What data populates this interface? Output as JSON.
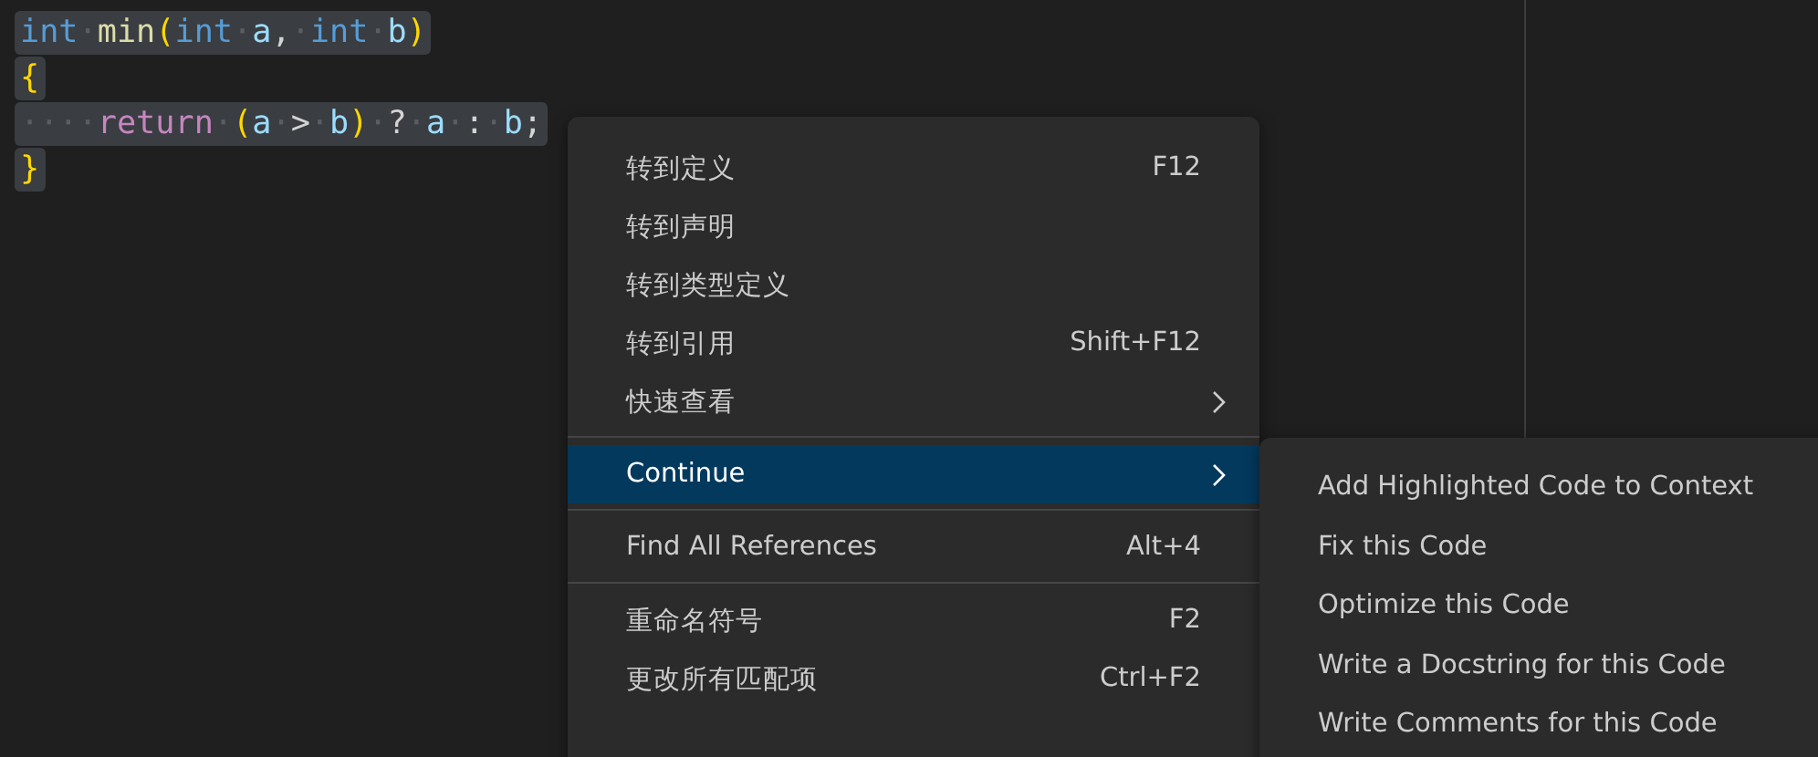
{
  "editor": {
    "lines": [
      [
        {
          "kind": "keyword",
          "text": "int"
        },
        {
          "kind": "space",
          "text": "·"
        },
        {
          "kind": "function",
          "text": "min"
        },
        {
          "kind": "bracket",
          "text": "("
        },
        {
          "kind": "keyword",
          "text": "int"
        },
        {
          "kind": "space",
          "text": "·"
        },
        {
          "kind": "variable",
          "text": "a"
        },
        {
          "kind": "punct",
          "text": ","
        },
        {
          "kind": "space",
          "text": "·"
        },
        {
          "kind": "keyword",
          "text": "int"
        },
        {
          "kind": "space",
          "text": "·"
        },
        {
          "kind": "variable",
          "text": "b"
        },
        {
          "kind": "bracket",
          "text": ")"
        }
      ],
      [
        {
          "kind": "bracket",
          "text": "{"
        }
      ],
      [
        {
          "kind": "space",
          "text": "····"
        },
        {
          "kind": "control",
          "text": "return"
        },
        {
          "kind": "space",
          "text": "·"
        },
        {
          "kind": "bracket",
          "text": "("
        },
        {
          "kind": "variable",
          "text": "a"
        },
        {
          "kind": "space",
          "text": "·"
        },
        {
          "kind": "punct",
          "text": ">"
        },
        {
          "kind": "space",
          "text": "·"
        },
        {
          "kind": "variable",
          "text": "b"
        },
        {
          "kind": "bracket",
          "text": ")"
        },
        {
          "kind": "space",
          "text": "·"
        },
        {
          "kind": "punct",
          "text": "?"
        },
        {
          "kind": "space",
          "text": "·"
        },
        {
          "kind": "variable",
          "text": "a"
        },
        {
          "kind": "space",
          "text": "·"
        },
        {
          "kind": "punct",
          "text": ":"
        },
        {
          "kind": "space",
          "text": "·"
        },
        {
          "kind": "variable",
          "text": "b"
        },
        {
          "kind": "punct",
          "text": ";"
        }
      ],
      [
        {
          "kind": "bracket",
          "text": "}"
        }
      ]
    ]
  },
  "context_menu": {
    "items": [
      {
        "kind": "item",
        "label": "转到定义",
        "shortcut": "F12",
        "submenu": false,
        "selected": false
      },
      {
        "kind": "item",
        "label": "转到声明",
        "submenu": false,
        "selected": false
      },
      {
        "kind": "item",
        "label": "转到类型定义",
        "submenu": false,
        "selected": false
      },
      {
        "kind": "item",
        "label": "转到引用",
        "shortcut": "Shift+F12",
        "submenu": false,
        "selected": false
      },
      {
        "kind": "item",
        "label": "快速查看",
        "submenu": true,
        "selected": false
      },
      {
        "kind": "separator"
      },
      {
        "kind": "item",
        "label": "Continue",
        "submenu": true,
        "selected": true
      },
      {
        "kind": "separator"
      },
      {
        "kind": "item",
        "label": "Find All References",
        "shortcut": "Alt+4",
        "submenu": false,
        "selected": false
      },
      {
        "kind": "separator"
      },
      {
        "kind": "item",
        "label": "重命名符号",
        "shortcut": "F2",
        "submenu": false,
        "selected": false
      },
      {
        "kind": "item",
        "label": "更改所有匹配项",
        "shortcut": "Ctrl+F2",
        "submenu": false,
        "selected": false
      }
    ]
  },
  "submenu": {
    "items": [
      {
        "label": "Add Highlighted Code to Context"
      },
      {
        "label": "Fix this Code"
      },
      {
        "label": "Optimize this Code"
      },
      {
        "label": "Write a Docstring for this Code"
      },
      {
        "label": "Write Comments for this Code"
      }
    ]
  }
}
